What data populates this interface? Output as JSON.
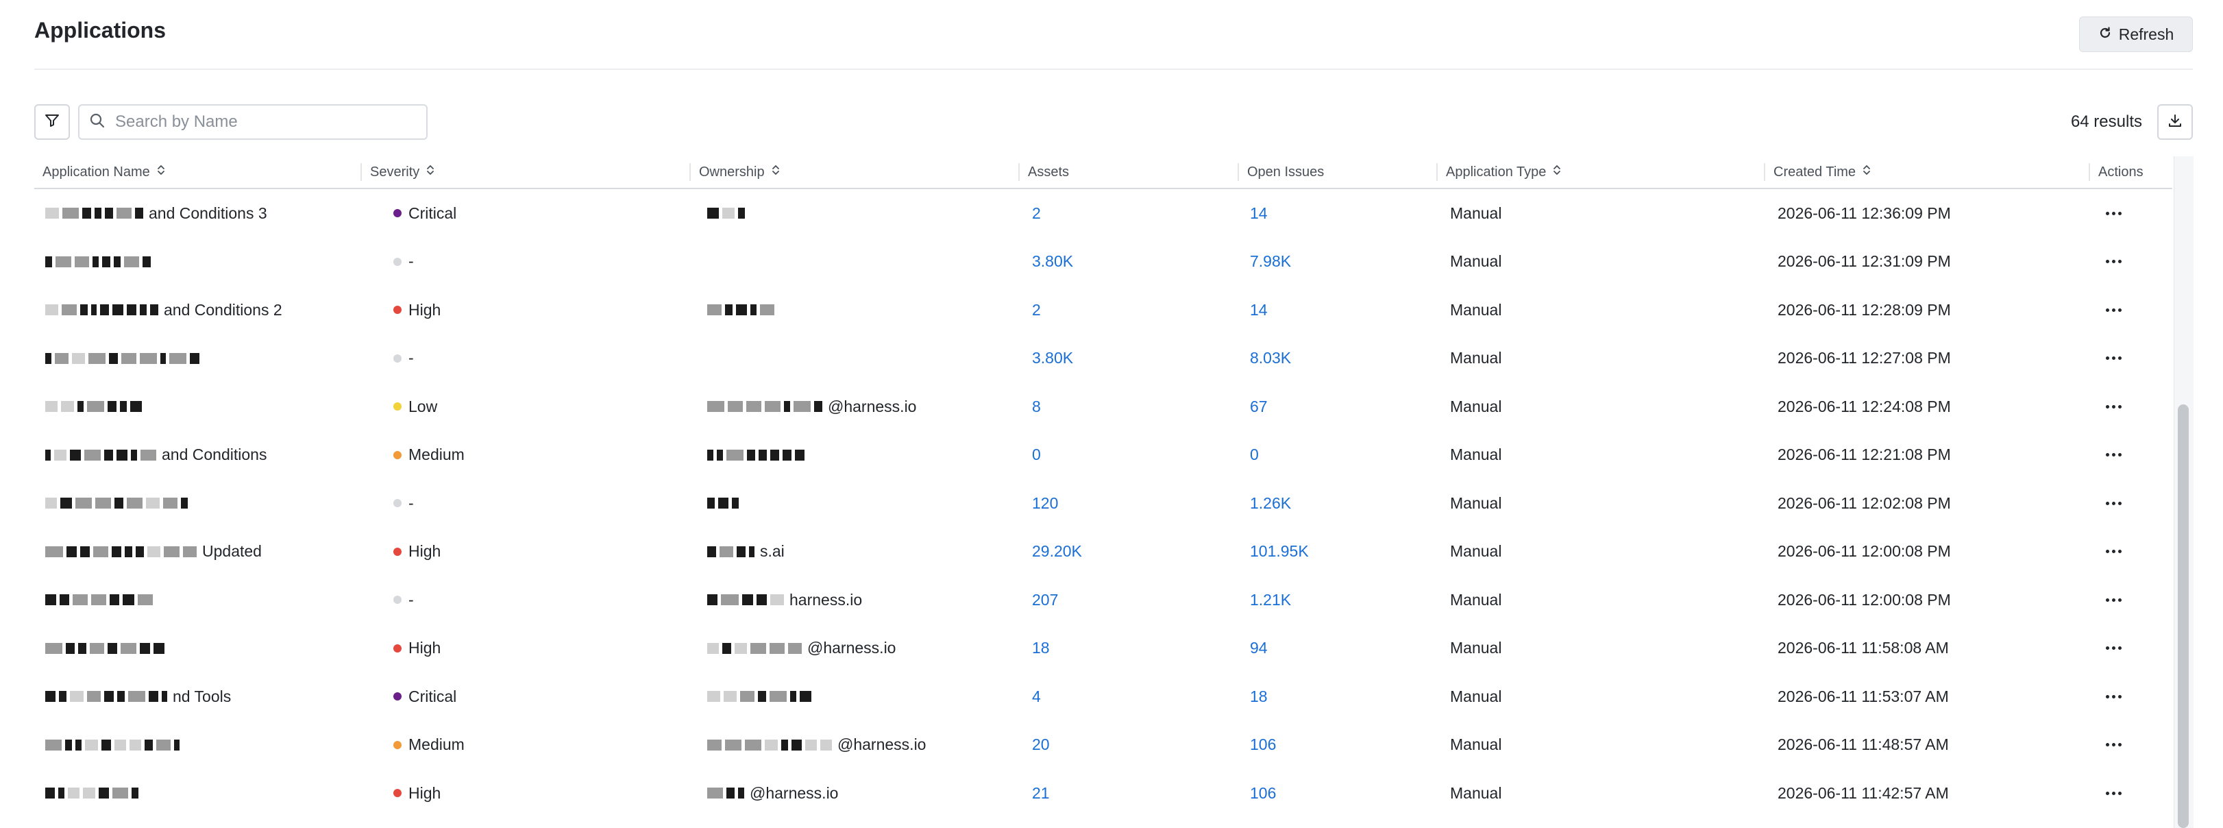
{
  "header": {
    "title": "Applications",
    "refresh_label": "Refresh",
    "refresh_icon": "refresh-icon"
  },
  "toolbar": {
    "filter_icon": "filter-icon",
    "search_placeholder": "Search by Name",
    "search_value": "",
    "results_text": "64 results",
    "download_icon": "download-icon"
  },
  "table": {
    "columns": [
      {
        "label": "Application Name",
        "sortable": true
      },
      {
        "label": "Severity",
        "sortable": true
      },
      {
        "label": "Ownership",
        "sortable": true
      },
      {
        "label": "Assets",
        "sortable": false
      },
      {
        "label": "Open Issues",
        "sortable": false
      },
      {
        "label": "Application Type",
        "sortable": true
      },
      {
        "label": "Created Time",
        "sortable": true
      },
      {
        "label": "Actions",
        "sortable": false
      }
    ],
    "rows": [
      {
        "name": "and Conditions 3",
        "severity": "Critical",
        "ownership": "",
        "assets": "2",
        "open_issues": "14",
        "type": "Manual",
        "created": "2026-06-11 12:36:09 PM"
      },
      {
        "name": "",
        "severity": "-",
        "ownership": "",
        "assets": "3.80K",
        "open_issues": "7.98K",
        "type": "Manual",
        "created": "2026-06-11 12:31:09 PM"
      },
      {
        "name": "and Conditions 2",
        "severity": "High",
        "ownership": "",
        "assets": "2",
        "open_issues": "14",
        "type": "Manual",
        "created": "2026-06-11 12:28:09 PM"
      },
      {
        "name": "",
        "severity": "-",
        "ownership": "",
        "assets": "3.80K",
        "open_issues": "8.03K",
        "type": "Manual",
        "created": "2026-06-11 12:27:08 PM"
      },
      {
        "name": "",
        "severity": "Low",
        "ownership": "@harness.io",
        "assets": "8",
        "open_issues": "67",
        "type": "Manual",
        "created": "2026-06-11 12:24:08 PM"
      },
      {
        "name": "and Conditions",
        "severity": "Medium",
        "ownership": "",
        "assets": "0",
        "open_issues": "0",
        "type": "Manual",
        "created": "2026-06-11 12:21:08 PM"
      },
      {
        "name": "",
        "severity": "-",
        "ownership": "",
        "assets": "120",
        "open_issues": "1.26K",
        "type": "Manual",
        "created": "2026-06-11 12:02:08 PM"
      },
      {
        "name": "Updated",
        "severity": "High",
        "ownership": "s.ai",
        "assets": "29.20K",
        "open_issues": "101.95K",
        "type": "Manual",
        "created": "2026-06-11 12:00:08 PM"
      },
      {
        "name": "",
        "severity": "-",
        "ownership": "harness.io",
        "assets": "207",
        "open_issues": "1.21K",
        "type": "Manual",
        "created": "2026-06-11 12:00:08 PM"
      },
      {
        "name": "",
        "severity": "High",
        "ownership": "@harness.io",
        "assets": "18",
        "open_issues": "94",
        "type": "Manual",
        "created": "2026-06-11 11:58:08 AM"
      },
      {
        "name": "nd Tools",
        "severity": "Critical",
        "ownership": "",
        "assets": "4",
        "open_issues": "18",
        "type": "Manual",
        "created": "2026-06-11 11:53:07 AM"
      },
      {
        "name": "",
        "severity": "Medium",
        "ownership": "@harness.io",
        "assets": "20",
        "open_issues": "106",
        "type": "Manual",
        "created": "2026-06-11 11:48:57 AM"
      },
      {
        "name": "",
        "severity": "High",
        "ownership": "@harness.io",
        "assets": "21",
        "open_issues": "106",
        "type": "Manual",
        "created": "2026-06-11 11:42:57 AM"
      }
    ]
  },
  "severity_colors": {
    "Critical": "#6b1f8a",
    "High": "#e5483d",
    "Medium": "#f29a3a",
    "Low": "#f2d23a",
    "-": "#d6d8db"
  },
  "colors": {
    "link": "#1a6fd6",
    "text": "#22252a"
  }
}
